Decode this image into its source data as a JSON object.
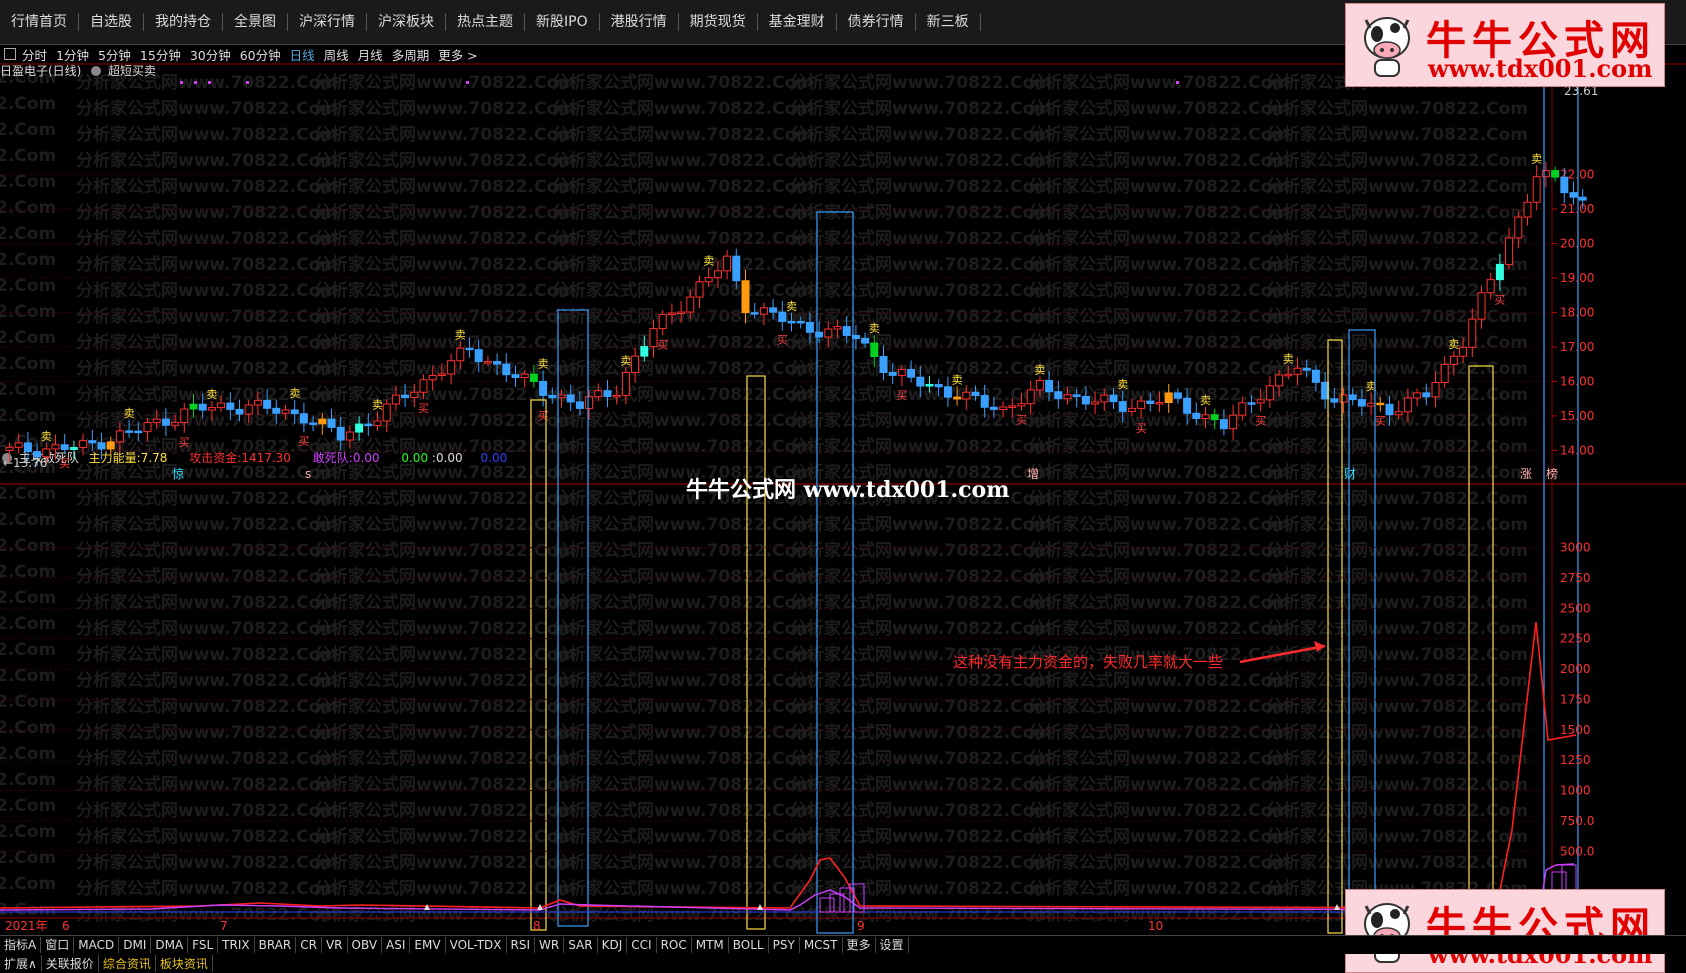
{
  "top_nav": [
    "行情首页",
    "自选股",
    "我的持仓",
    "全景图",
    "沪深行情",
    "沪深板块",
    "热点主题",
    "新股IPO",
    "港股行情",
    "期货现货",
    "基金理财",
    "债券行情",
    "新三板"
  ],
  "period_bar": {
    "items": [
      "分时",
      "1分钟",
      "5分钟",
      "15分钟",
      "30分钟",
      "60分钟",
      "日线",
      "周线",
      "月线",
      "多周期",
      "更多 >"
    ],
    "active": "日线"
  },
  "chart_header": {
    "stock": "日盈电子(日线)",
    "indicator": "超短买卖"
  },
  "main_chart": {
    "y_ticks": [
      "22.00",
      "21.00",
      "20.00",
      "19.00",
      "18.00",
      "17.00",
      "16.00",
      "15.00",
      "14.00"
    ],
    "y_range": [
      13.2,
      24.8
    ],
    "low_label": "←13.76",
    "high_label": "23.61",
    "sell_label": "卖",
    "buy_label": "买",
    "bottom_marks": [
      "惊",
      "s",
      "增",
      "财",
      "涨",
      "榜"
    ],
    "candle_colors": {
      "up": "#ff3030",
      "down": "#3aa0ff",
      "cyan": "#30ffe0",
      "green": "#00d020",
      "orange": "#ff9a10",
      "yellow": "#ffe040"
    }
  },
  "center_watermark": "牛牛公式网 www.tdx001.com",
  "background_watermark": "分析家公式网www.70822.Com",
  "background_watermark_fragment": "2.Com",
  "indicator_header": {
    "name": "主攻敢死队",
    "main_energy_label": "主力能量:",
    "main_energy_value": "7.78",
    "attack_label": "攻击资金:",
    "attack_value": "1417.30",
    "dare_label": "敢死队:",
    "dare_value": "0.00",
    "v1": "0.00",
    "v2": "0.00",
    "v3": "0.00"
  },
  "indicator_chart": {
    "y_ticks": [
      "3000",
      "2750",
      "2500",
      "2250",
      "2000",
      "1750",
      "1500",
      "1250",
      "1000",
      "750.0",
      "500.0"
    ],
    "y_range": [
      0,
      3350
    ]
  },
  "annotation": "这种没有主力资金的，失败几率就大一些",
  "time_axis": {
    "labels": [
      "2021年",
      "6",
      "7",
      "8",
      "9",
      "10"
    ]
  },
  "bottom_tabs": [
    "指标A",
    "窗口",
    "MACD",
    "DMI",
    "DMA",
    "FSL",
    "TRIX",
    "BRAR",
    "CR",
    "VR",
    "OBV",
    "ASI",
    "EMV",
    "VOL-TDX",
    "RSI",
    "WR",
    "SAR",
    "KDJ",
    "CCI",
    "ROC",
    "MTM",
    "BOLL",
    "PSY",
    "MCST",
    "更多",
    "设置"
  ],
  "bottom_tabs2": [
    "扩展∧",
    "关联报价",
    "综合资讯",
    "板块资讯"
  ],
  "logo": {
    "title": "牛牛公式网",
    "url": "www.tdx001.com"
  }
}
